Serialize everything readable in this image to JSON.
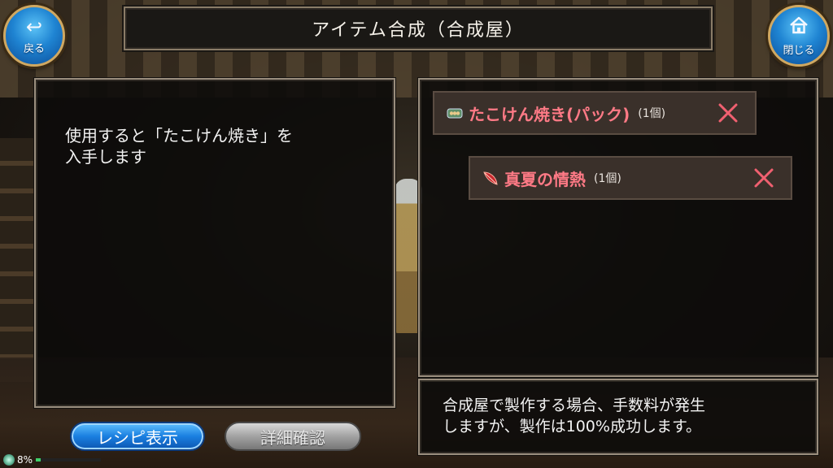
{
  "title": "アイテム合成（合成屋）",
  "nav": {
    "back_label": "戻る",
    "close_label": "閉じる"
  },
  "description": "使用すると「たこけん焼き」を\n入手します",
  "ingredients": [
    {
      "name": "たこけん焼き(パック)",
      "qty": "(1個)",
      "icon": "takoken-pack-icon"
    },
    {
      "name": "真夏の情熱",
      "qty": "(1個)",
      "icon": "red-feather-icon"
    }
  ],
  "note": "合成屋で製作する場合、手数料が発生\nしますが、製作は100%成功します。",
  "buttons": {
    "recipe_label": "レシピ表示",
    "details_label": "詳細確認"
  },
  "status": {
    "percent_label": "8%",
    "progress": 0.08
  },
  "colors": {
    "ingredient_name": "#ff7a86",
    "remove_x": "#f06070",
    "blue_button": "#1a7fe0"
  }
}
